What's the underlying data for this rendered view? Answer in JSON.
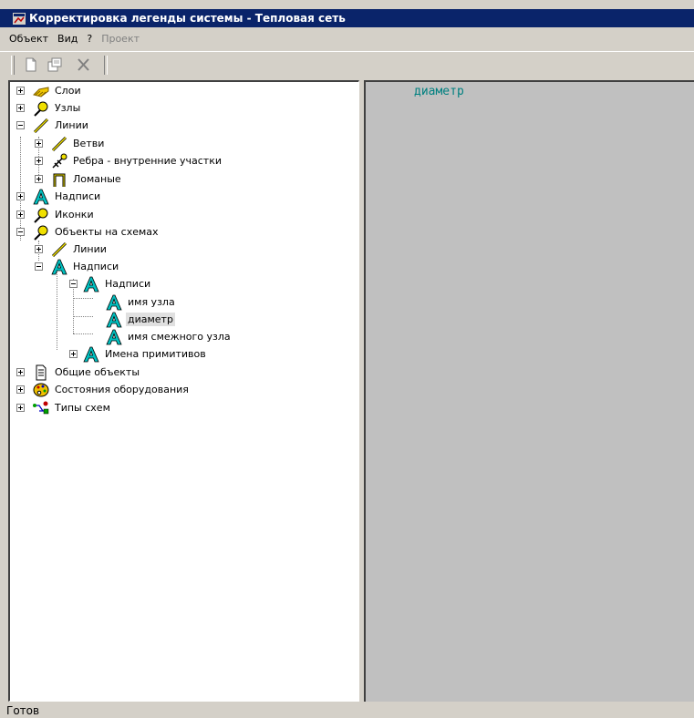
{
  "window": {
    "title": "Корректировка легенды системы - Тепловая сеть"
  },
  "menu": {
    "object": "Объект",
    "view": "Вид",
    "help": "?",
    "project": "Проект"
  },
  "tree": {
    "layers": "Слои",
    "nodes": "Узлы",
    "lines": "Линии",
    "branches": "Ветви",
    "edges": "Ребра - внутренние участки",
    "polylines": "Ломаные",
    "labels": "Надписи",
    "icons": "Иконки",
    "scheme_objects": "Объекты на схемах",
    "scheme_lines": "Линии",
    "scheme_labels": "Надписи",
    "scheme_labels_sub": "Надписи",
    "node_name": "имя узла",
    "diameter": "диаметр",
    "adjacent_node_name": "имя смежного узла",
    "primitive_names": "Имена примитивов",
    "common_objects": "Общие объекты",
    "equipment_states": "Состояния оборудования",
    "scheme_types": "Типы схем"
  },
  "preview": {
    "text": "диаметр",
    "text_color": "#008080",
    "background": "#c0c0c0"
  },
  "status": {
    "text": "Готов"
  }
}
